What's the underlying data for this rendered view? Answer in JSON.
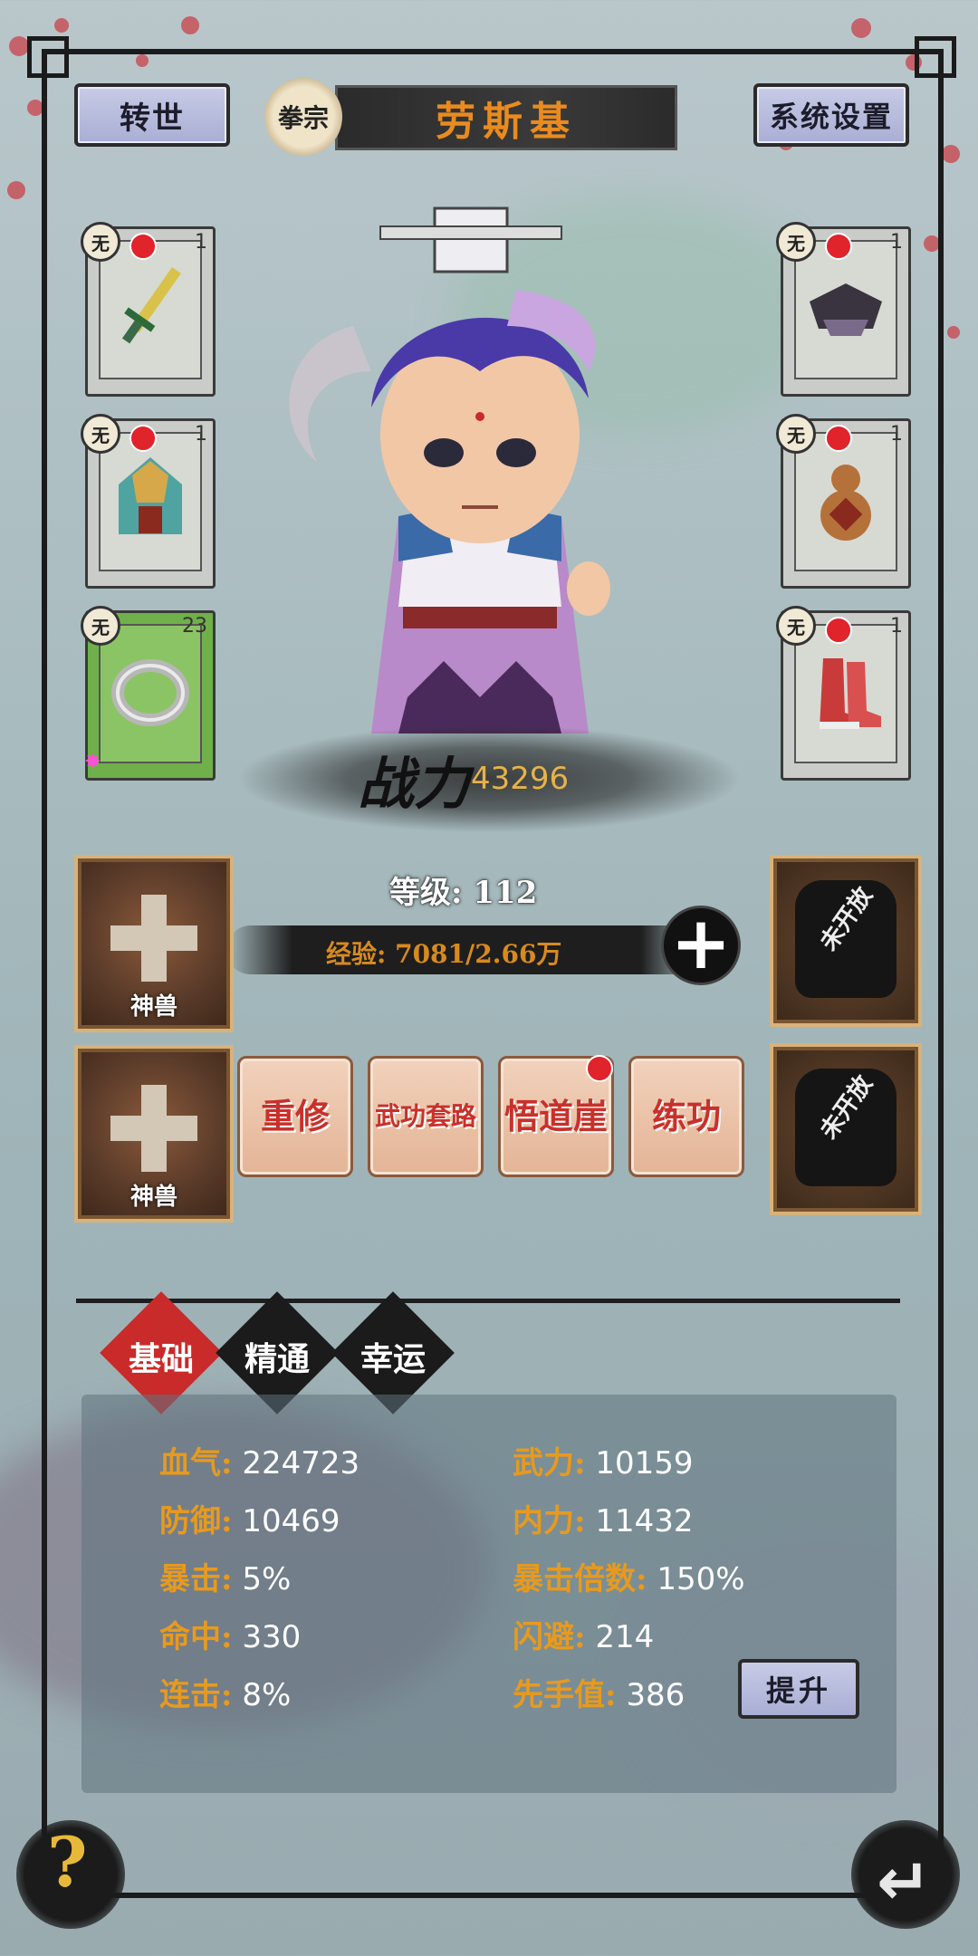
{
  "top_bar": {
    "reincarnate_label": "转世",
    "sect_label": "拳宗",
    "player_name": "劳斯基",
    "settings_label": "系统设置"
  },
  "equipment": {
    "grade_label": "无",
    "left": [
      {
        "name": "weapon-sword",
        "count": "1"
      },
      {
        "name": "armor-helmet",
        "count": "1"
      },
      {
        "name": "ring",
        "count": "23"
      }
    ],
    "right": [
      {
        "name": "hat",
        "count": "1"
      },
      {
        "name": "gourd",
        "count": "1"
      },
      {
        "name": "boots",
        "count": "1"
      }
    ]
  },
  "combat": {
    "power_label": "战力",
    "power_value": "43296",
    "level_text": "等级: 112",
    "exp_text": "经验: 7081/2.66万"
  },
  "beasts": {
    "label": "神兽",
    "locked_label": "未开放"
  },
  "functions": [
    {
      "label": "重修"
    },
    {
      "label": "武功套路"
    },
    {
      "label": "悟道崖"
    },
    {
      "label": "练功"
    }
  ],
  "tabs": {
    "basic": "基础",
    "mastery": "精通",
    "luck": "幸运"
  },
  "stats": {
    "hp_label": "血气:",
    "hp": "224723",
    "atk_label": "武力:",
    "atk": "10159",
    "def_label": "防御:",
    "def": "10469",
    "inner_label": "内力:",
    "inner": "11432",
    "crit_label": "暴击:",
    "crit": "5%",
    "crit_mult_label": "暴击倍数:",
    "crit_mult": "150%",
    "hit_label": "命中:",
    "hit": "330",
    "dodge_label": "闪避:",
    "dodge": "214",
    "combo_label": "连击:",
    "combo": "8%",
    "initiative_label": "先手值:",
    "initiative": "386",
    "upgrade_label": "提升"
  },
  "corner": {
    "help_symbol": "?",
    "return_symbol": "↵"
  }
}
